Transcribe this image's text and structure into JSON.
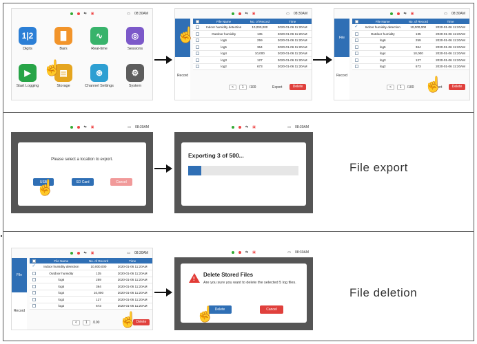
{
  "status": {
    "time": "08:30AM"
  },
  "home": {
    "tiles": [
      {
        "label": "Digits",
        "glyph": "1|2",
        "color": "#2c7fd6",
        "icon": "digits-icon"
      },
      {
        "label": "Bars",
        "glyph": "▐▌",
        "color": "#f2942a",
        "icon": "bars-icon"
      },
      {
        "label": "Real-time",
        "glyph": "∿",
        "color": "#38b36b",
        "icon": "realtime-icon"
      },
      {
        "label": "Sessions",
        "glyph": "◎",
        "color": "#7c59c9",
        "icon": "sessions-icon"
      },
      {
        "label": "Start Logging",
        "glyph": "▶",
        "color": "#27a447",
        "icon": "play-icon"
      },
      {
        "label": "Storage",
        "glyph": "▤",
        "color": "#e5a51f",
        "icon": "storage-icon"
      },
      {
        "label": "Channel Settings",
        "glyph": "⊛",
        "color": "#2d9fd2",
        "icon": "channel-settings-icon"
      },
      {
        "label": "System",
        "glyph": "⚙",
        "color": "#5d5d5d",
        "icon": "system-icon"
      }
    ]
  },
  "records": {
    "sidebar": {
      "file": "File",
      "record": "Record"
    },
    "headers": {
      "name": "File Name",
      "count": "No. of Record",
      "time": "Time"
    },
    "rows": [
      {
        "name": "Indoor humidity detection",
        "count": "10,000,000",
        "time": "2020-01-06 11:20AM"
      },
      {
        "name": "Outdoor humidity",
        "count": "135",
        "time": "2020-01-06 11:20AM"
      },
      {
        "name": "log6",
        "count": "259",
        "time": "2020-01-06 11:20AM"
      },
      {
        "name": "log5",
        "count": "364",
        "time": "2020-01-06 11:20AM"
      },
      {
        "name": "log4",
        "count": "10,000",
        "time": "2020-01-06 11:20AM"
      },
      {
        "name": "log3",
        "count": "127",
        "time": "2020-01-06 11:20AM"
      },
      {
        "name": "log2",
        "count": "673",
        "time": "2020-01-06 11:20AM"
      }
    ],
    "pager": {
      "page": "1",
      "total": "/100",
      "prev": "<",
      "next": ">"
    },
    "export_label": "Export",
    "delete_label": "Delete"
  },
  "export": {
    "prompt": "Please select a location to export.",
    "usb": "USB",
    "sd": "SD Card",
    "cancel": "Cancel",
    "progress_text": "Exporting 3 of 500...",
    "progress_fraction": 0.12,
    "caption": "File export"
  },
  "deletion": {
    "title": "Delete Stored Files",
    "message": "Are you sure you want to delete the selected 5 log files.",
    "delete": "Delete",
    "cancel": "Cancel",
    "caption": "File deletion"
  }
}
